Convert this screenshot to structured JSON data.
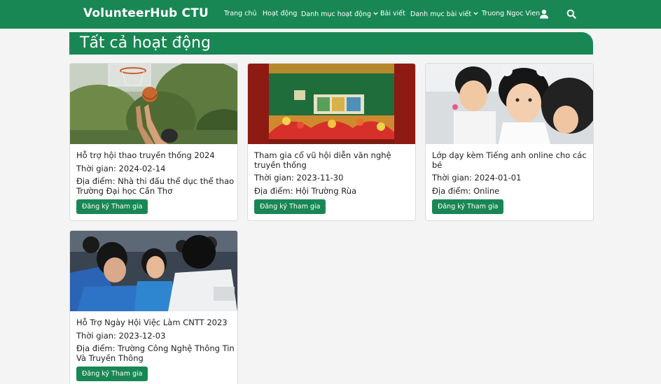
{
  "navbar": {
    "brand": "VolunteerHub CTU",
    "items": [
      {
        "label": "Trang chủ"
      },
      {
        "label": "Hoạt động"
      },
      {
        "label": "Danh mục hoạt động",
        "has_dropdown": true
      },
      {
        "label": "Bài viết"
      },
      {
        "label": "Danh mục bài viết",
        "has_dropdown": true
      },
      {
        "label": "Truong Ngoc Vien",
        "icon": "user-icon"
      }
    ],
    "search_icon": "search-icon",
    "color": "#198754"
  },
  "page": {
    "title": "Tất cả hoạt động"
  },
  "activities": [
    {
      "title": "Hỗ trợ hội thao truyền thống 2024",
      "time": "Thời gian: 2024-02-14",
      "location": "Địa điểm: Nhà thi đấu thể dục thể thao Trường Đại học Cần Thơ",
      "button": "Đăng ký Tham gia",
      "image": "basketball-photo"
    },
    {
      "title": "Tham gia cổ vũ hội diễn văn nghệ truyền thống",
      "time": "Thời gian: 2023-11-30",
      "location": "Địa điểm: Hội Trường Rùa",
      "button": "Đăng ký Tham gia",
      "image": "stage-performance-photo"
    },
    {
      "title": "Lớp dạy kèm Tiếng anh online cho các bé",
      "time": "Thời gian: 2024-01-01",
      "location": "Địa điểm: Online",
      "button": "Đăng ký Tham gia",
      "image": "children-photo"
    },
    {
      "title": "Hỗ Trợ Ngày Hội Việc Làm CNTT 2023",
      "time": "Thời gian: 2023-12-03",
      "location": "Địa điểm: Trường Công Nghệ Thông Tin Và Truyền Thông",
      "button": "Đăng ký Tham gia",
      "image": "job-fair-crowd-photo"
    }
  ]
}
